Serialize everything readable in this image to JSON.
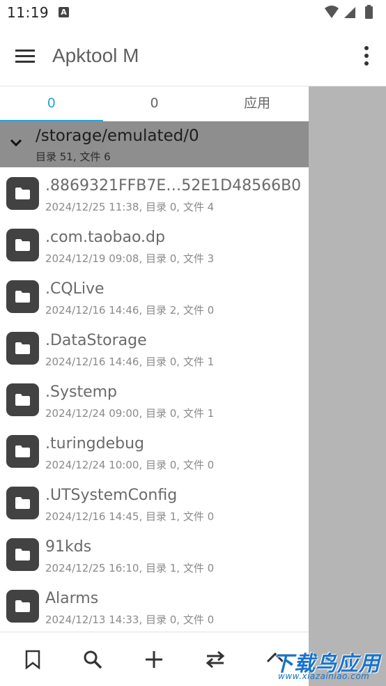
{
  "status": {
    "time": "11:19",
    "notif_badge": "A"
  },
  "appbar": {
    "title": "Apktool M",
    "menu_icon": "hamburger-menu-icon",
    "more_icon": "more-vert-icon"
  },
  "tabs": [
    {
      "label": "0",
      "active": true
    },
    {
      "label": "0",
      "active": false
    },
    {
      "label": "应用",
      "active": false
    }
  ],
  "path": {
    "title": "/storage/emulated/0",
    "summary": "目录 51, 文件 6"
  },
  "files": [
    {
      "name": ".8869321FFB7E…52E1D48566B0",
      "meta": "2024/12/25 11:38, 目录 0, 文件 4"
    },
    {
      "name": ".com.taobao.dp",
      "meta": "2024/12/19 09:08, 目录 0, 文件 3"
    },
    {
      "name": ".CQLive",
      "meta": "2024/12/16 14:46, 目录 2, 文件 0"
    },
    {
      "name": ".DataStorage",
      "meta": "2024/12/16 14:46, 目录 0, 文件 1"
    },
    {
      "name": ".Systemp",
      "meta": "2024/12/24 09:00, 目录 0, 文件 1"
    },
    {
      "name": ".turingdebug",
      "meta": "2024/12/24 10:00, 目录 0, 文件 0"
    },
    {
      "name": ".UTSystemConfig",
      "meta": "2024/12/16 14:45, 目录 1, 文件 0"
    },
    {
      "name": "91kds",
      "meta": "2024/12/25 16:10, 目录 1, 文件 0"
    },
    {
      "name": "Alarms",
      "meta": "2024/12/13 14:33, 目录 0, 文件 0"
    }
  ],
  "bottom_icons": [
    "bookmark-icon",
    "search-icon",
    "add-icon",
    "swap-icon",
    "up-arrow-icon"
  ],
  "watermark": {
    "main": "下载鸟应用",
    "sub": "www.xiazainiao.com"
  },
  "colors": {
    "accent": "#2aa5d8",
    "path_header": "#8e8e8e",
    "folder": "#424242",
    "side_pane": "#b5b5b5"
  }
}
